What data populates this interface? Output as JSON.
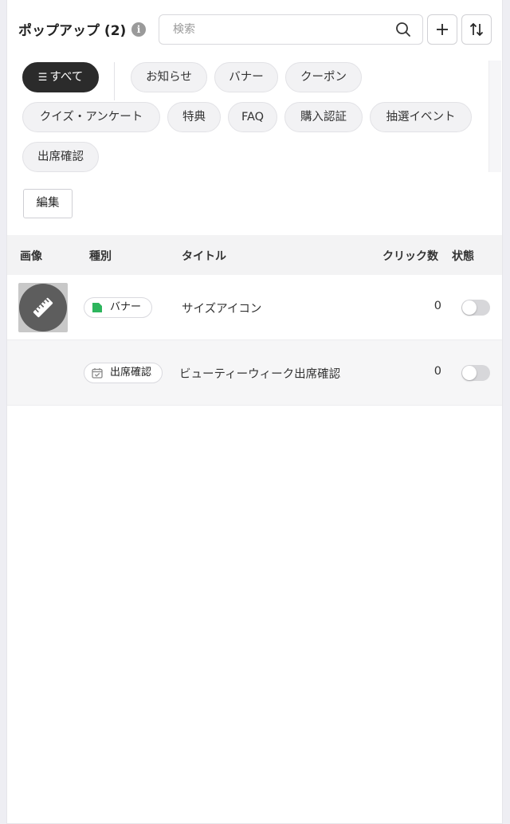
{
  "header": {
    "title": "ポップアップ (2)",
    "info_icon": "info-icon",
    "search_placeholder": "検索",
    "search_value": "",
    "add_icon": "plus-icon",
    "sort_icon": "sort-icon"
  },
  "filters": {
    "active": "すべて",
    "chips": [
      "すべて",
      "お知らせ",
      "バナー",
      "クーポン",
      "クイズ・アンケート",
      "特典",
      "FAQ",
      "購入認証",
      "抽選イベント",
      "出席確認"
    ]
  },
  "edit_label": "編集",
  "table": {
    "columns": [
      "画像",
      "種別",
      "タイトル",
      "クリック数",
      "状態"
    ],
    "rows": [
      {
        "type": "バナー",
        "type_icon": "banner-icon",
        "type_color": "#2db55d",
        "title": "サイズアイコン",
        "clicks": "0",
        "enabled": false,
        "has_image": true,
        "image_icon": "ruler-icon"
      },
      {
        "type": "出席確認",
        "type_icon": "calendar-check-icon",
        "type_color": "#888888",
        "title": "ビューティーウィーク出席確認",
        "clicks": "0",
        "enabled": false,
        "has_image": false
      }
    ]
  }
}
